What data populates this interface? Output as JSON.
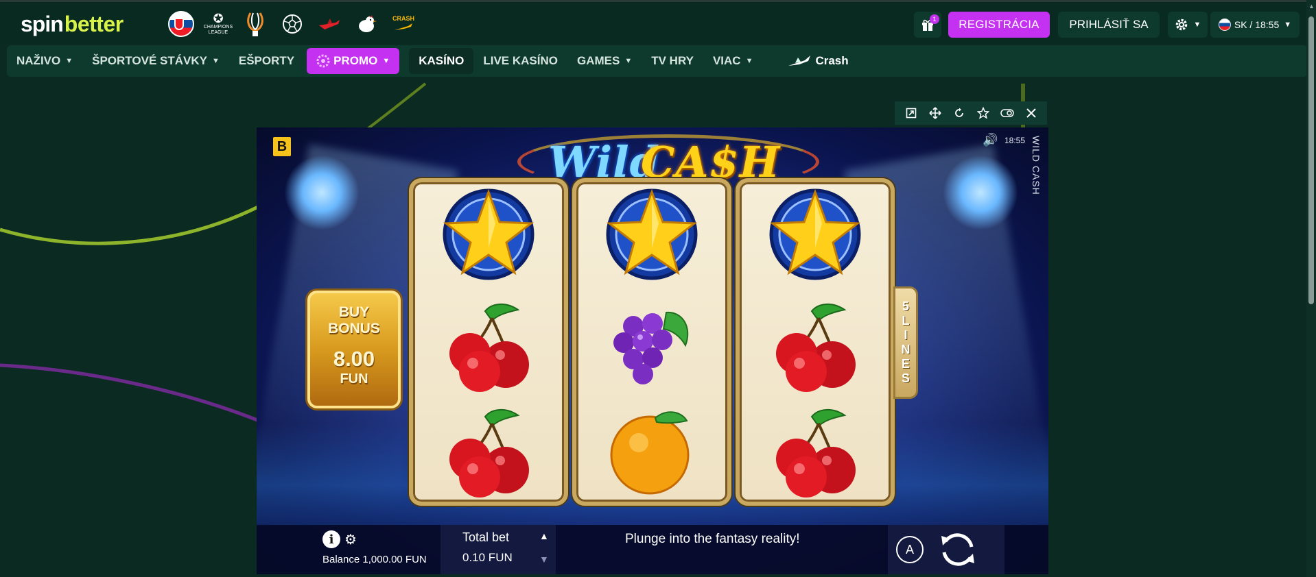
{
  "brand": {
    "spin": "spin",
    "better": "better"
  },
  "quick_links": [
    {
      "icon": "slovakia-flag-icon"
    },
    {
      "icon": "champions-league-icon",
      "label": "CHAMPIONS LEAGUE"
    },
    {
      "icon": "europa-league-icon"
    },
    {
      "icon": "football-icon"
    },
    {
      "icon": "aviator-plane-icon"
    },
    {
      "icon": "chicken-game-icon"
    },
    {
      "icon": "crash-game-icon",
      "label": "CRASH"
    }
  ],
  "header": {
    "gift_badge": "1",
    "register_label": "REGISTRÁCIA",
    "login_label": "PRIHLÁSIŤ SA",
    "language_time": "SK / 18:55"
  },
  "nav": {
    "items": [
      {
        "label": "NAŽIVO",
        "dropdown": true
      },
      {
        "label": "ŠPORTOVÉ STÁVKY",
        "dropdown": true
      },
      {
        "label": "EŠPORTY",
        "dropdown": false
      },
      {
        "label": "PROMO",
        "dropdown": true
      },
      {
        "label": "KASÍNO",
        "dropdown": false
      },
      {
        "label": "LIVE KASÍNO",
        "dropdown": false
      },
      {
        "label": "GAMES",
        "dropdown": true
      },
      {
        "label": "TV HRY",
        "dropdown": false
      },
      {
        "label": "VIAC",
        "dropdown": true
      },
      {
        "label": "Crash",
        "dropdown": false
      }
    ]
  },
  "game_toolbar": [
    "open-external-icon",
    "move-icon",
    "reload-icon",
    "favorite-star-icon",
    "toggle-icon",
    "close-icon"
  ],
  "game": {
    "provider_badge": "B",
    "title_wild": "Wild",
    "title_cash": "CA$H",
    "clock": "18:55",
    "side_title": "WILD CASH",
    "buy_bonus": {
      "line1": "BUY",
      "line2": "BONUS",
      "price": "8.00",
      "currency": "FUN"
    },
    "lines": [
      "5",
      "L",
      "I",
      "N",
      "E",
      "S"
    ],
    "reels": [
      [
        "star",
        "cherry",
        "cherry"
      ],
      [
        "star",
        "grapes",
        "orange"
      ],
      [
        "star",
        "cherry",
        "cherry"
      ]
    ],
    "balance": "Balance 1,000.00 FUN",
    "total_bet_label": "Total bet",
    "total_bet_value": "0.10 FUN",
    "tagline": "Plunge into the fantasy reality!",
    "auto_label": "A"
  },
  "colors": {
    "accent": "#c531f0",
    "lime": "#d8f24a",
    "panel": "#0e3a2e"
  }
}
